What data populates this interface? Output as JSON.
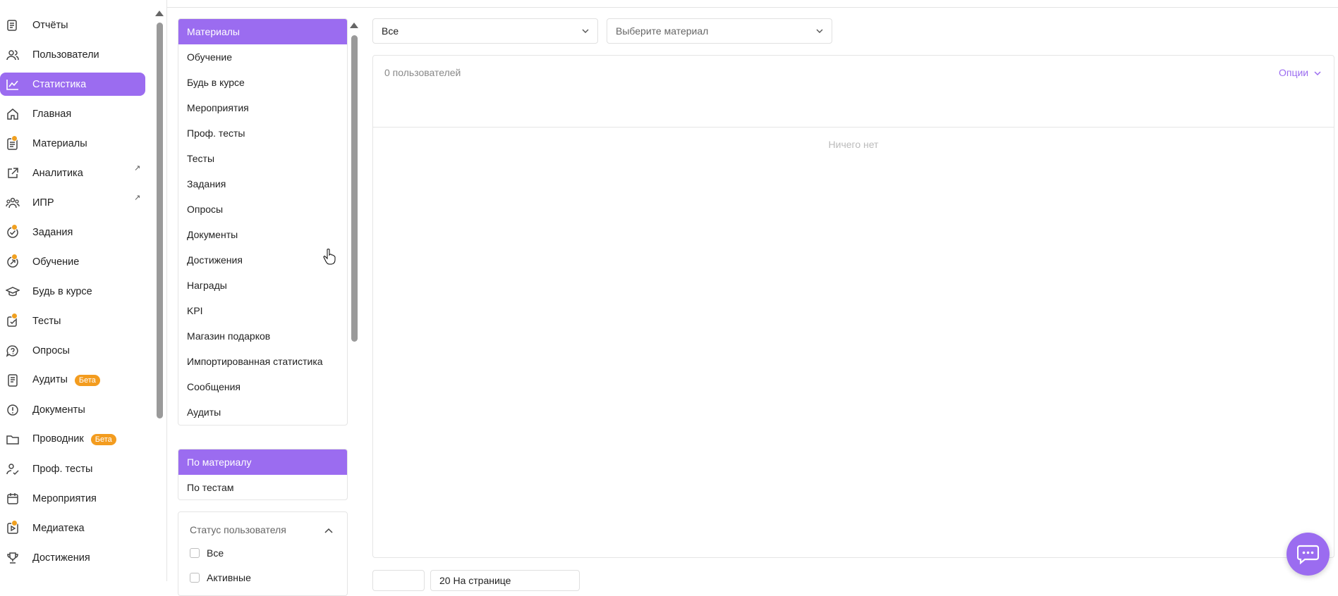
{
  "nav": {
    "items": [
      {
        "label": "Отчёты",
        "icon": "reports-icon",
        "dot": false,
        "ext": false,
        "beta": ""
      },
      {
        "label": "Пользователи",
        "icon": "users-icon",
        "dot": false,
        "ext": false,
        "beta": ""
      },
      {
        "label": "Статистика",
        "icon": "chart-line-icon",
        "dot": false,
        "ext": false,
        "beta": "",
        "active": true
      },
      {
        "label": "Главная",
        "icon": "home-icon",
        "dot": false,
        "ext": false,
        "beta": ""
      },
      {
        "label": "Материалы",
        "icon": "document-list-icon",
        "dot": true,
        "ext": false,
        "beta": ""
      },
      {
        "label": "Аналитика",
        "icon": "external-link-icon",
        "dot": false,
        "ext": true,
        "beta": ""
      },
      {
        "label": "ИПР",
        "icon": "team-icon",
        "dot": false,
        "ext": true,
        "beta": ""
      },
      {
        "label": "Задания",
        "icon": "check-circle-icon",
        "dot": true,
        "ext": false,
        "beta": ""
      },
      {
        "label": "Обучение",
        "icon": "learning-arrow-icon",
        "dot": true,
        "ext": false,
        "beta": ""
      },
      {
        "label": "Будь в курсе",
        "icon": "graduation-cap-icon",
        "dot": false,
        "ext": false,
        "beta": ""
      },
      {
        "label": "Тесты",
        "icon": "test-check-icon",
        "dot": true,
        "ext": false,
        "beta": ""
      },
      {
        "label": "Опросы",
        "icon": "question-bubble-icon",
        "dot": false,
        "ext": false,
        "beta": ""
      },
      {
        "label": "Аудиты",
        "icon": "audit-icon",
        "dot": false,
        "ext": false,
        "beta": "Бета"
      },
      {
        "label": "Документы",
        "icon": "alert-circle-icon",
        "dot": false,
        "ext": false,
        "beta": ""
      },
      {
        "label": "Проводник",
        "icon": "folder-icon",
        "dot": false,
        "ext": false,
        "beta": "Бета"
      },
      {
        "label": "Проф. тесты",
        "icon": "user-check-icon",
        "dot": false,
        "ext": false,
        "beta": ""
      },
      {
        "label": "Мероприятия",
        "icon": "calendar-icon",
        "dot": false,
        "ext": false,
        "beta": ""
      },
      {
        "label": "Медиатека",
        "icon": "media-play-icon",
        "dot": true,
        "ext": false,
        "beta": ""
      },
      {
        "label": "Достижения",
        "icon": "trophy-icon",
        "dot": false,
        "ext": false,
        "beta": ""
      }
    ]
  },
  "materials": {
    "header": "Материалы",
    "items": [
      "Обучение",
      "Будь в курсе",
      "Мероприятия",
      "Проф. тесты",
      "Тесты",
      "Задания",
      "Опросы",
      "Документы",
      "Достижения",
      "Награды",
      "KPI",
      "Магазин подарков",
      "Импортированная статистика",
      "Сообщения",
      "Аудиты"
    ]
  },
  "grouping": {
    "selected": "По материалу",
    "other": "По тестам"
  },
  "status_filter": {
    "title": "Статус пользователя",
    "options": [
      "Все",
      "Активные"
    ]
  },
  "filters": {
    "type_value": "Все",
    "material_placeholder": "Выберите материал"
  },
  "results": {
    "count": "0 пользователей",
    "options": "Опции",
    "empty": "Ничего нет"
  },
  "pagination": {
    "per_page": "20 На странице"
  }
}
